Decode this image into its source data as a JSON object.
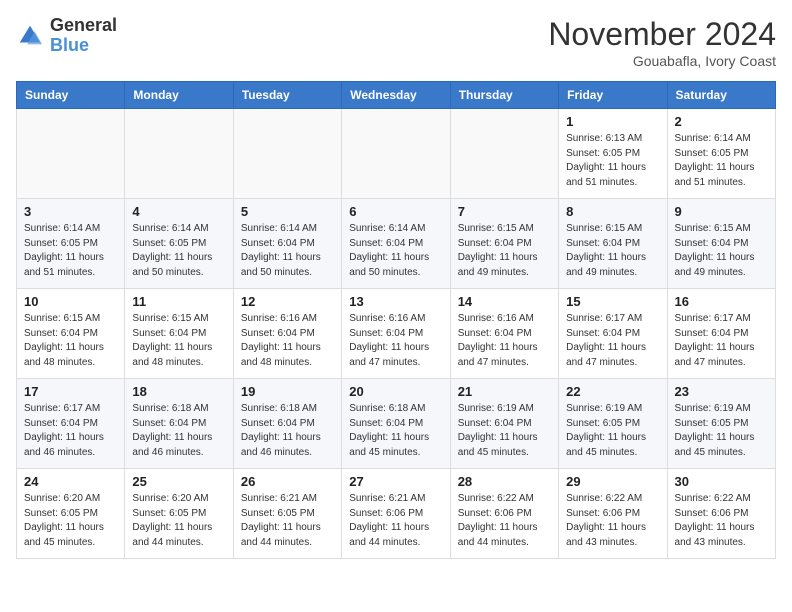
{
  "header": {
    "logo_general": "General",
    "logo_blue": "Blue",
    "month_title": "November 2024",
    "location": "Gouabafla, Ivory Coast"
  },
  "days_of_week": [
    "Sunday",
    "Monday",
    "Tuesday",
    "Wednesday",
    "Thursday",
    "Friday",
    "Saturday"
  ],
  "weeks": [
    [
      {
        "day": "",
        "info": ""
      },
      {
        "day": "",
        "info": ""
      },
      {
        "day": "",
        "info": ""
      },
      {
        "day": "",
        "info": ""
      },
      {
        "day": "",
        "info": ""
      },
      {
        "day": "1",
        "info": "Sunrise: 6:13 AM\nSunset: 6:05 PM\nDaylight: 11 hours\nand 51 minutes."
      },
      {
        "day": "2",
        "info": "Sunrise: 6:14 AM\nSunset: 6:05 PM\nDaylight: 11 hours\nand 51 minutes."
      }
    ],
    [
      {
        "day": "3",
        "info": "Sunrise: 6:14 AM\nSunset: 6:05 PM\nDaylight: 11 hours\nand 51 minutes."
      },
      {
        "day": "4",
        "info": "Sunrise: 6:14 AM\nSunset: 6:05 PM\nDaylight: 11 hours\nand 50 minutes."
      },
      {
        "day": "5",
        "info": "Sunrise: 6:14 AM\nSunset: 6:04 PM\nDaylight: 11 hours\nand 50 minutes."
      },
      {
        "day": "6",
        "info": "Sunrise: 6:14 AM\nSunset: 6:04 PM\nDaylight: 11 hours\nand 50 minutes."
      },
      {
        "day": "7",
        "info": "Sunrise: 6:15 AM\nSunset: 6:04 PM\nDaylight: 11 hours\nand 49 minutes."
      },
      {
        "day": "8",
        "info": "Sunrise: 6:15 AM\nSunset: 6:04 PM\nDaylight: 11 hours\nand 49 minutes."
      },
      {
        "day": "9",
        "info": "Sunrise: 6:15 AM\nSunset: 6:04 PM\nDaylight: 11 hours\nand 49 minutes."
      }
    ],
    [
      {
        "day": "10",
        "info": "Sunrise: 6:15 AM\nSunset: 6:04 PM\nDaylight: 11 hours\nand 48 minutes."
      },
      {
        "day": "11",
        "info": "Sunrise: 6:15 AM\nSunset: 6:04 PM\nDaylight: 11 hours\nand 48 minutes."
      },
      {
        "day": "12",
        "info": "Sunrise: 6:16 AM\nSunset: 6:04 PM\nDaylight: 11 hours\nand 48 minutes."
      },
      {
        "day": "13",
        "info": "Sunrise: 6:16 AM\nSunset: 6:04 PM\nDaylight: 11 hours\nand 47 minutes."
      },
      {
        "day": "14",
        "info": "Sunrise: 6:16 AM\nSunset: 6:04 PM\nDaylight: 11 hours\nand 47 minutes."
      },
      {
        "day": "15",
        "info": "Sunrise: 6:17 AM\nSunset: 6:04 PM\nDaylight: 11 hours\nand 47 minutes."
      },
      {
        "day": "16",
        "info": "Sunrise: 6:17 AM\nSunset: 6:04 PM\nDaylight: 11 hours\nand 47 minutes."
      }
    ],
    [
      {
        "day": "17",
        "info": "Sunrise: 6:17 AM\nSunset: 6:04 PM\nDaylight: 11 hours\nand 46 minutes."
      },
      {
        "day": "18",
        "info": "Sunrise: 6:18 AM\nSunset: 6:04 PM\nDaylight: 11 hours\nand 46 minutes."
      },
      {
        "day": "19",
        "info": "Sunrise: 6:18 AM\nSunset: 6:04 PM\nDaylight: 11 hours\nand 46 minutes."
      },
      {
        "day": "20",
        "info": "Sunrise: 6:18 AM\nSunset: 6:04 PM\nDaylight: 11 hours\nand 45 minutes."
      },
      {
        "day": "21",
        "info": "Sunrise: 6:19 AM\nSunset: 6:04 PM\nDaylight: 11 hours\nand 45 minutes."
      },
      {
        "day": "22",
        "info": "Sunrise: 6:19 AM\nSunset: 6:05 PM\nDaylight: 11 hours\nand 45 minutes."
      },
      {
        "day": "23",
        "info": "Sunrise: 6:19 AM\nSunset: 6:05 PM\nDaylight: 11 hours\nand 45 minutes."
      }
    ],
    [
      {
        "day": "24",
        "info": "Sunrise: 6:20 AM\nSunset: 6:05 PM\nDaylight: 11 hours\nand 45 minutes."
      },
      {
        "day": "25",
        "info": "Sunrise: 6:20 AM\nSunset: 6:05 PM\nDaylight: 11 hours\nand 44 minutes."
      },
      {
        "day": "26",
        "info": "Sunrise: 6:21 AM\nSunset: 6:05 PM\nDaylight: 11 hours\nand 44 minutes."
      },
      {
        "day": "27",
        "info": "Sunrise: 6:21 AM\nSunset: 6:06 PM\nDaylight: 11 hours\nand 44 minutes."
      },
      {
        "day": "28",
        "info": "Sunrise: 6:22 AM\nSunset: 6:06 PM\nDaylight: 11 hours\nand 44 minutes."
      },
      {
        "day": "29",
        "info": "Sunrise: 6:22 AM\nSunset: 6:06 PM\nDaylight: 11 hours\nand 43 minutes."
      },
      {
        "day": "30",
        "info": "Sunrise: 6:22 AM\nSunset: 6:06 PM\nDaylight: 11 hours\nand 43 minutes."
      }
    ]
  ]
}
